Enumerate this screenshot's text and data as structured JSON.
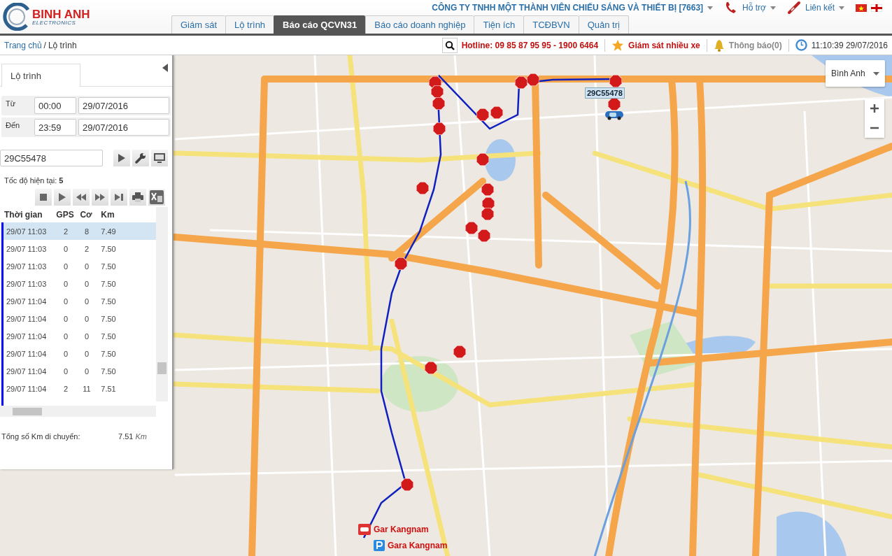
{
  "logo": {
    "name": "BINH ANH",
    "sub": "ELECTRONICS"
  },
  "company": "CÔNG TY TNHH MỘT THÀNH VIÊN CHIẾU SÁNG VÀ THIẾT BỊ [7663]",
  "header_links": [
    "Hỗ trợ",
    "Liên kết"
  ],
  "tabs": [
    {
      "label": "Giám sát",
      "selected": false
    },
    {
      "label": "Lộ trình",
      "selected": false
    },
    {
      "label": "Báo cáo QCVN31",
      "selected": true
    },
    {
      "label": "Báo cáo doanh nghiệp",
      "selected": false
    },
    {
      "label": "Tiện ích",
      "selected": false
    },
    {
      "label": "TCĐBVN",
      "selected": false
    },
    {
      "label": "Quản trị",
      "selected": false
    }
  ],
  "breadcrumb": {
    "home": "Trang chủ",
    "separator": "/",
    "current": "Lộ trình"
  },
  "status": {
    "hotline": "Hotline: 09 85 87 95 95 - 1900 6464",
    "multi_monitor": "Giám sát nhiều xe",
    "notifications": "Thông báo(0)",
    "clock": "11:10:39 29/07/2016"
  },
  "panel": {
    "tab": "Lộ trình",
    "from": {
      "label": "Từ",
      "time": "00:00",
      "date": "29/07/2016"
    },
    "to": {
      "label": "Đến",
      "time": "23:59",
      "date": "29/07/2016"
    },
    "vehicle": "29C55478",
    "speed_label": "Tốc độ hiện tại:",
    "speed": "5",
    "columns": [
      "Thời gian",
      "GPS",
      "Cơ",
      "Km"
    ],
    "rows": [
      {
        "time": "29/07 11:03",
        "gps": "2",
        "co": "8",
        "km": "7.49",
        "selected": true
      },
      {
        "time": "29/07 11:03",
        "gps": "0",
        "co": "2",
        "km": "7.50",
        "selected": false
      },
      {
        "time": "29/07 11:03",
        "gps": "0",
        "co": "0",
        "km": "7.50",
        "selected": false
      },
      {
        "time": "29/07 11:03",
        "gps": "0",
        "co": "0",
        "km": "7.50",
        "selected": false
      },
      {
        "time": "29/07 11:04",
        "gps": "0",
        "co": "0",
        "km": "7.50",
        "selected": false
      },
      {
        "time": "29/07 11:04",
        "gps": "0",
        "co": "0",
        "km": "7.50",
        "selected": false
      },
      {
        "time": "29/07 11:04",
        "gps": "0",
        "co": "0",
        "km": "7.50",
        "selected": false
      },
      {
        "time": "29/07 11:04",
        "gps": "0",
        "co": "0",
        "km": "7.50",
        "selected": false
      },
      {
        "time": "29/07 11:04",
        "gps": "0",
        "co": "0",
        "km": "7.50",
        "selected": false
      },
      {
        "time": "29/07 11:04",
        "gps": "2",
        "co": "11",
        "km": "7.51",
        "selected": false
      }
    ],
    "total_label": "Tổng số Km di chuyển:",
    "total_value": "7.51",
    "total_unit": "Km"
  },
  "map": {
    "map_type": "Bình Anh",
    "vehicle_label": "29C55478",
    "places": [
      {
        "label": "Gar Kangnam",
        "kind": "garage"
      },
      {
        "label": "Gara Kangnam",
        "kind": "parking"
      }
    ]
  }
}
